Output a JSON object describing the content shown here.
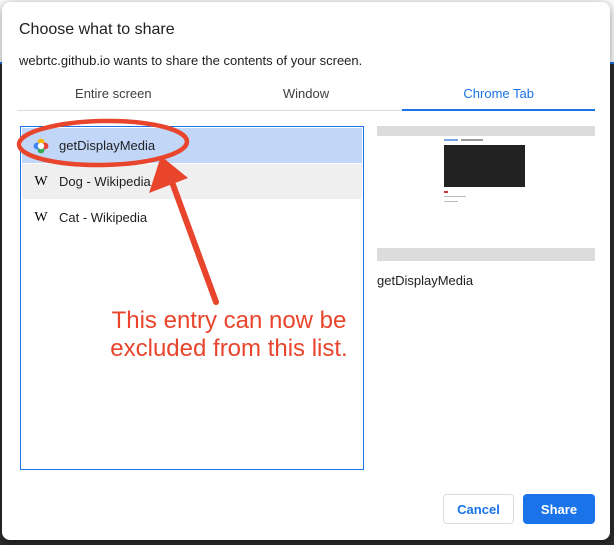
{
  "dialog": {
    "title": "Choose what to share",
    "subtitle": "webrtc.github.io wants to share the contents of your screen."
  },
  "tabs": [
    {
      "label": "Entire screen",
      "active": false
    },
    {
      "label": "Window",
      "active": false
    },
    {
      "label": "Chrome Tab",
      "active": true
    }
  ],
  "tab_list": [
    {
      "label": "getDisplayMedia",
      "icon": "webrtc-icon",
      "state": "selected"
    },
    {
      "label": "Dog - Wikipedia",
      "icon": "wikipedia-icon",
      "state": "hover"
    },
    {
      "label": "Cat - Wikipedia",
      "icon": "wikipedia-icon",
      "state": "normal"
    }
  ],
  "wiki_glyph": "W",
  "preview": {
    "label": "getDisplayMedia"
  },
  "annotation": {
    "line1": "This entry can now be",
    "line2": "excluded from this list.",
    "color": "#e8452c"
  },
  "buttons": {
    "cancel": "Cancel",
    "share": "Share"
  },
  "colors": {
    "accent": "#1a73e8",
    "selected_row": "#c2d7f8"
  }
}
